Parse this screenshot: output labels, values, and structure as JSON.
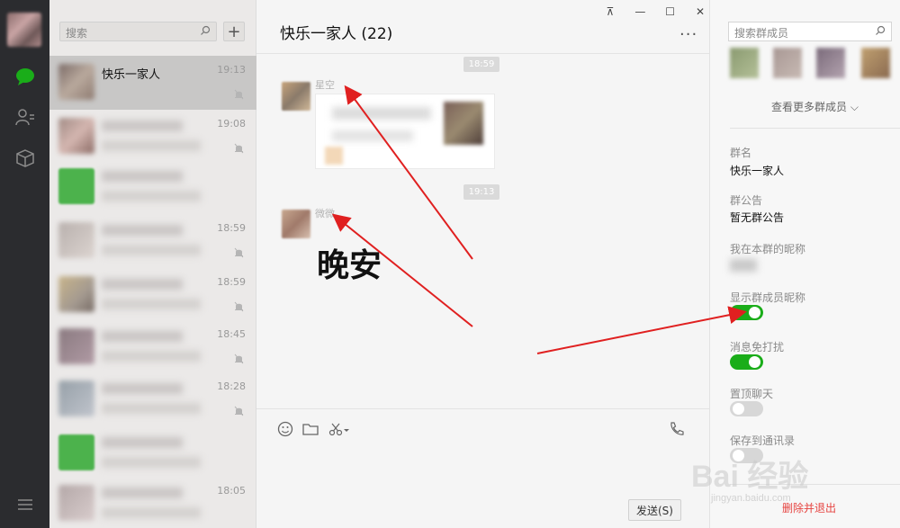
{
  "list": {
    "search_placeholder": "搜索",
    "rows": [
      {
        "name": "快乐一家人",
        "time": "19:13"
      },
      {
        "time": "19:08"
      },
      {
        "time": ""
      },
      {
        "time": "18:59"
      },
      {
        "time": "18:59"
      },
      {
        "time": "18:45"
      },
      {
        "time": "18:28"
      },
      {
        "time": ""
      },
      {
        "time": "18:05"
      }
    ]
  },
  "chat": {
    "title": "快乐一家人 (22)",
    "more": "···",
    "stamps": [
      "18:59",
      "19:13"
    ],
    "messages": [
      {
        "sender": "星空"
      },
      {
        "sender": "微微"
      }
    ],
    "sticker_text": "晚安",
    "send_label": "发送(S)"
  },
  "window": {
    "pin": "⊼",
    "minimize": "—",
    "maximize": "☐",
    "close": "✕"
  },
  "info": {
    "member_search_placeholder": "搜索群成员",
    "view_more": "查看更多群成员 ⌵",
    "group_name_label": "群名",
    "group_name": "快乐一家人",
    "notice_label": "群公告",
    "notice": "暂无群公告",
    "nickname_label": "我在本群的昵称",
    "show_nick_label": "显示群成员昵称",
    "mute_label": "消息免打扰",
    "pin_label": "置顶聊天",
    "save_label": "保存到通讯录",
    "exit_label": "删除并退出",
    "toggles": {
      "show_nick": true,
      "mute": true,
      "pin": false,
      "save": false
    }
  },
  "watermark": {
    "brand": "Bai 经验",
    "url": "jingyan.baidu.com"
  },
  "colors": {
    "accent_green": "#1aad19",
    "arrow_red": "#e02020",
    "danger_red": "#e64340",
    "rail": "#2b2c2f"
  },
  "icons": [
    "chat-icon",
    "contacts-icon",
    "collection-icon",
    "menu-icon",
    "search-icon",
    "plus-icon",
    "mute-bell-icon",
    "emoji-icon",
    "folder-icon",
    "scissors-icon",
    "call-icon",
    "chevron-down-icon"
  ]
}
